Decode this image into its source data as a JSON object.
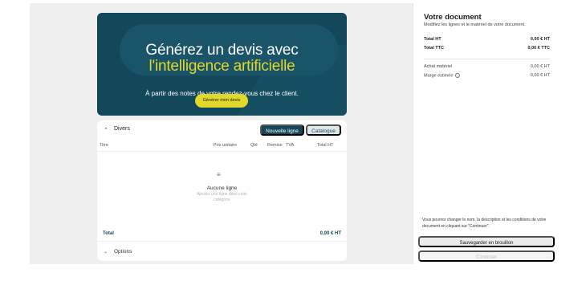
{
  "hero": {
    "title_line1": "Générez un devis avec",
    "title_line2": "l'intelligence artificielle",
    "subtitle": "À partir des notes de votre rendez-vous chez le client.",
    "button_label": "Générer mon devis"
  },
  "section": {
    "title": "Divers",
    "new_line_label": "Nouvelle ligne",
    "catalog_label": "Catalogue",
    "columns": [
      "Titre",
      "Prix unitaire",
      "Qté",
      "Remise",
      "TVA",
      "Total HT"
    ],
    "empty_title": "Aucune ligne",
    "empty_desc": "Ajoutez une ligne dans cette catégorie",
    "total_label": "Total",
    "total_value": "0,00 € HT",
    "options_label": "Options"
  },
  "document": {
    "title": "Votre document",
    "subtitle": "Modifiez les lignes et le matériel de votre document.",
    "total_ht_label": "Total HT",
    "total_ht_value": "0,00 € HT",
    "total_ttc_label": "Total TTC",
    "total_ttc_value": "0,00 € TTC",
    "achat_label": "Achat matériel",
    "achat_value": "0,00 € HT",
    "marge_label": "Marge estimée",
    "marge_value": "0,00 € HT",
    "note": "Vous pourrez changer le nom, la description et les conditions de votre document en cliquant sur \"Continuer\".",
    "draft_button": "Sauvegarder en brouillon",
    "continue_button": "Continuer"
  },
  "icons": {
    "collapse": "chevron-up-icon",
    "expand": "chevron-down-icon",
    "empty_list": "list-icon",
    "info": "info-icon"
  },
  "colors": {
    "brand": "#13475a",
    "accent": "#e0d82b"
  }
}
